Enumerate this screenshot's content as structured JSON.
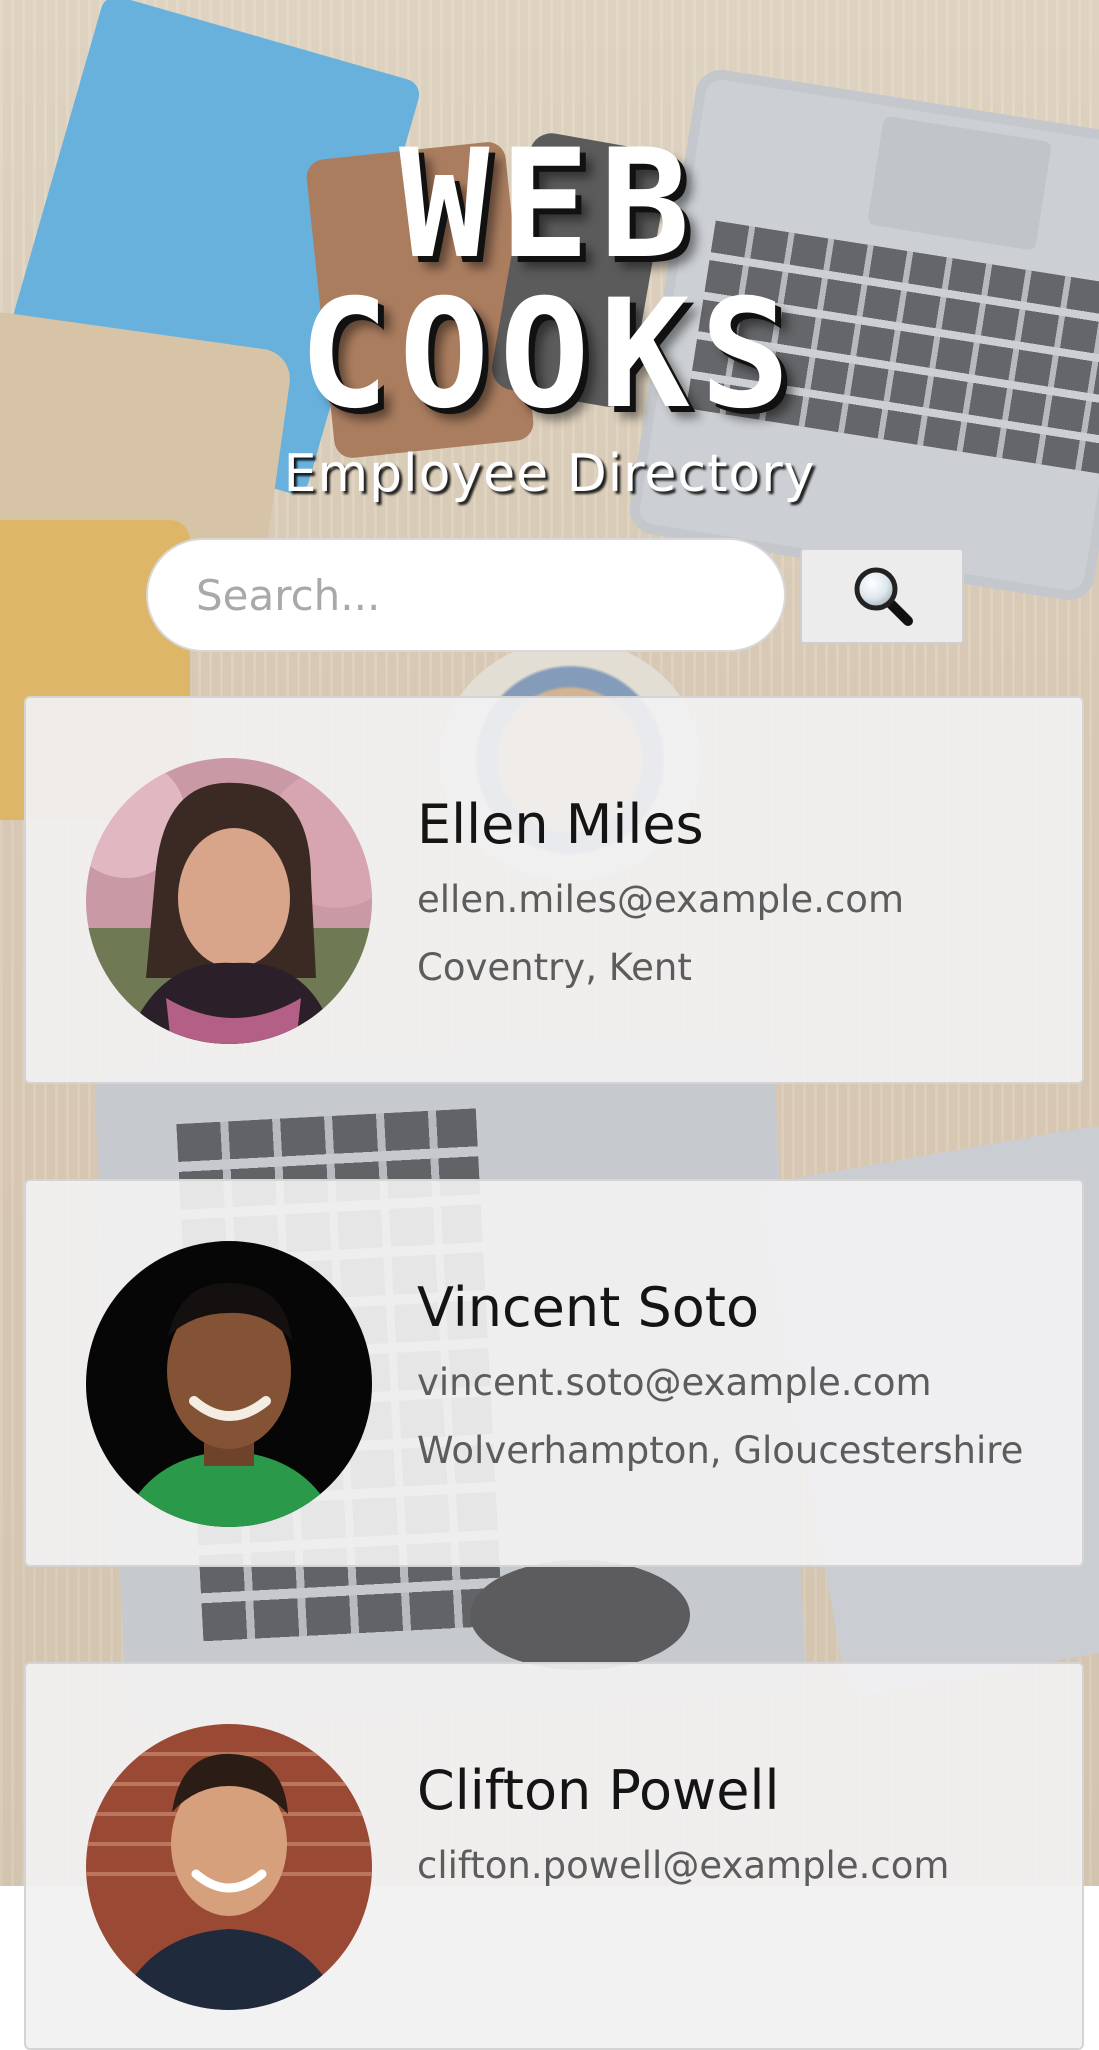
{
  "header": {
    "logo_line1": "WEB",
    "logo_line2": "COOKS",
    "subtitle": "Employee Directory"
  },
  "search": {
    "placeholder": "Search...",
    "value": "",
    "button_icon": "search-icon"
  },
  "employees": [
    {
      "name": "Ellen Miles",
      "email": "ellen.miles@example.com",
      "location": "Coventry, Kent"
    },
    {
      "name": "Vincent Soto",
      "email": "vincent.soto@example.com",
      "location": "Wolverhampton, Gloucestershire"
    },
    {
      "name": "Clifton Powell",
      "email": "clifton.powell@example.com",
      "location": ""
    }
  ],
  "colors": {
    "card_background": "#f2f1f2",
    "name_text": "#141414",
    "detail_text": "#5c5c5c",
    "search_button": "#ececec"
  }
}
